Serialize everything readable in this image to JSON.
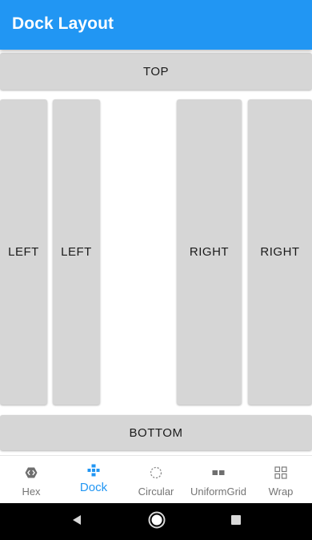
{
  "app_bar": {
    "title": "Dock Layout",
    "color": "#2196f3"
  },
  "dock": {
    "top": "TOP",
    "left_1": "LEFT",
    "left_2": "LEFT",
    "right_1": "RIGHT",
    "right_2": "RIGHT",
    "bottom": "BOTTOM"
  },
  "tabs": [
    {
      "label": "Hex",
      "icon": "hex-code-icon",
      "active": false
    },
    {
      "label": "Dock",
      "icon": "dock-icon",
      "active": true
    },
    {
      "label": "Circular",
      "icon": "circular-icon",
      "active": false
    },
    {
      "label": "UniformGrid",
      "icon": "uniform-grid-icon",
      "active": false
    },
    {
      "label": "Wrap",
      "icon": "wrap-icon",
      "active": false
    }
  ],
  "colors": {
    "accent": "#2196f3",
    "button": "#d6d6d6",
    "inactive_tab": "#757575"
  },
  "nav_bar": {
    "buttons": [
      "back-icon",
      "home-icon",
      "recents-icon"
    ]
  }
}
